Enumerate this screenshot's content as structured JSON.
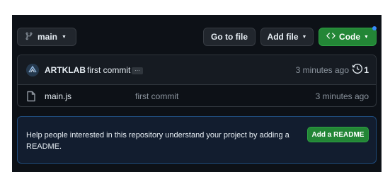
{
  "toolbar": {
    "branch_label": "main",
    "go_to_file_label": "Go to file",
    "add_file_label": "Add file",
    "code_label": "Code"
  },
  "latest_commit": {
    "author": "ARTKLAB",
    "message": "first commit",
    "time": "3 minutes ago",
    "commit_count": "1"
  },
  "files": [
    {
      "name": "main.js",
      "commit_message": "first commit",
      "time": "3 minutes ago"
    }
  ],
  "readme_banner": {
    "text": "Help people interested in this repository understand your project by adding a README.",
    "button_label": "Add a README"
  },
  "colors": {
    "background": "#0d1117",
    "green_button": "#238636",
    "notification_dot": "#388bfd",
    "banner_border": "#1f4a7a"
  },
  "icons": [
    "git-branch-icon",
    "chevron-down-icon",
    "code-icon",
    "avatar",
    "history-icon",
    "file-icon"
  ]
}
